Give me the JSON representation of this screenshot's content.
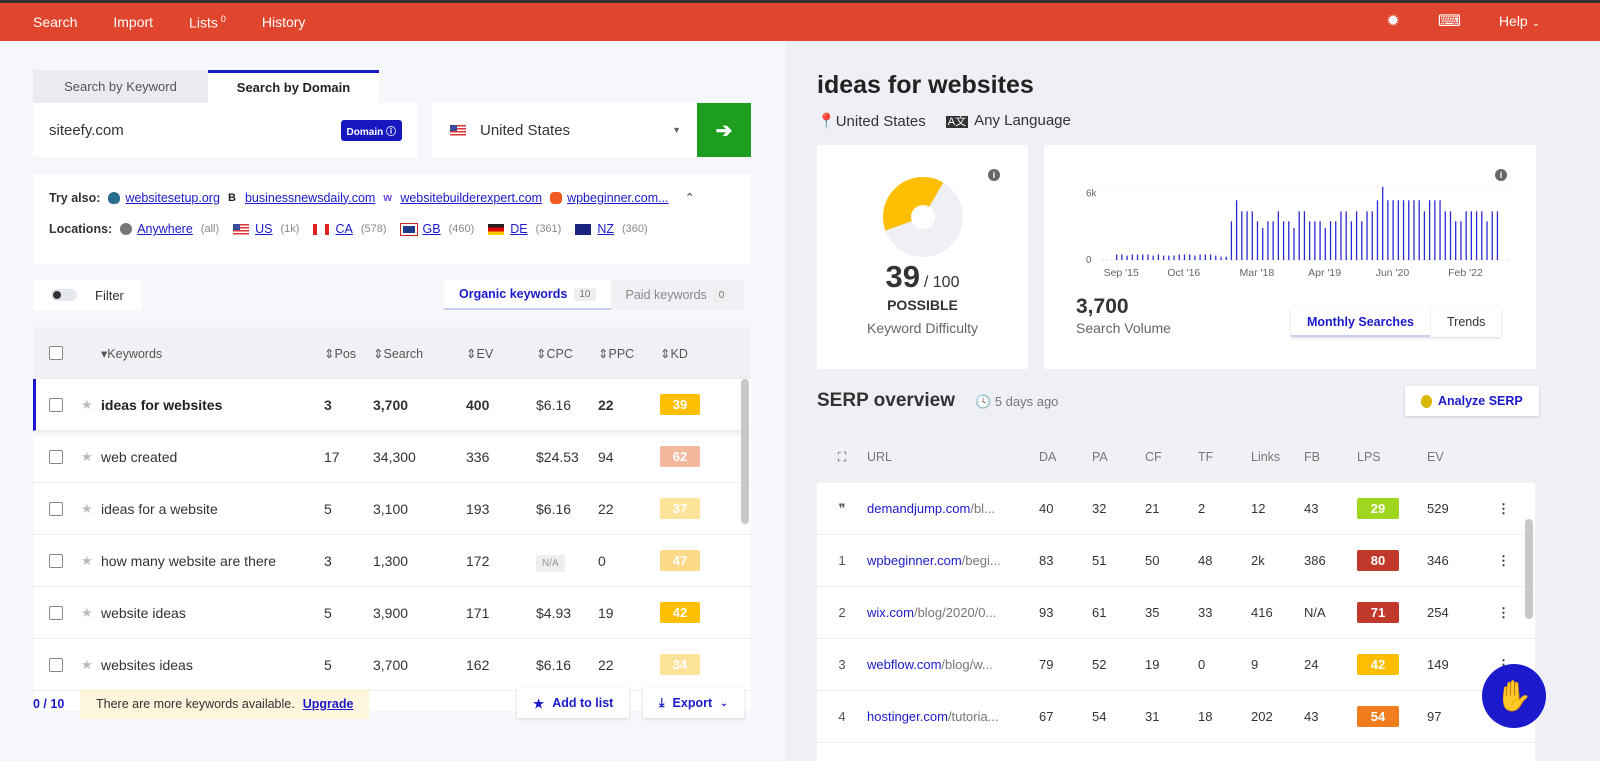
{
  "nav": {
    "items": [
      "Search",
      "Import",
      "Lists",
      "History"
    ],
    "lists_count": "0",
    "help": "Help",
    "icons": [
      "bug-icon",
      "keyboard-icon"
    ]
  },
  "search": {
    "tabs": [
      "Search by Keyword",
      "Search by Domain"
    ],
    "active_tab": "Search by Domain",
    "value": "siteefy.com",
    "badge": "Domain",
    "location": "United States",
    "go_icon": "arrow-right-icon"
  },
  "try_also": {
    "label": "Try also:",
    "sites": [
      "websitesetup.org",
      "businessnewsdaily.com",
      "websitebuilderexpert.com",
      "wpbeginner.com..."
    ],
    "locations_label": "Locations:",
    "locations": [
      {
        "name": "Anywhere",
        "count": "(all)"
      },
      {
        "name": "US",
        "count": "(1k)"
      },
      {
        "name": "CA",
        "count": "(578)"
      },
      {
        "name": "GB",
        "count": "(460)"
      },
      {
        "name": "DE",
        "count": "(361)"
      },
      {
        "name": "NZ",
        "count": "(360)"
      }
    ]
  },
  "filter": {
    "label": "Filter"
  },
  "kw_tabs": [
    {
      "label": "Organic keywords",
      "count": "10"
    },
    {
      "label": "Paid keywords",
      "count": "0"
    }
  ],
  "kw_table": {
    "headers": [
      "Keywords",
      "Pos",
      "Search",
      "EV",
      "CPC",
      "PPC",
      "KD"
    ],
    "rows": [
      {
        "kw": "ideas for websites",
        "pos": "3",
        "search": "3,700",
        "ev": "400",
        "cpc": "$6.16",
        "ppc": "22",
        "kd": "39",
        "color": "#ffbf00"
      },
      {
        "kw": "web created",
        "pos": "17",
        "search": "34,300",
        "ev": "336",
        "cpc": "$24.53",
        "ppc": "94",
        "kd": "62",
        "color": "#f3b79e"
      },
      {
        "kw": "ideas for a website",
        "pos": "5",
        "search": "3,100",
        "ev": "193",
        "cpc": "$6.16",
        "ppc": "22",
        "kd": "37",
        "color": "#fde29a"
      },
      {
        "kw": "how many website are there",
        "pos": "3",
        "search": "1,300",
        "ev": "172",
        "cpc": "N/A",
        "ppc": "0",
        "kd": "47",
        "color": "#fdd98a"
      },
      {
        "kw": "website ideas",
        "pos": "5",
        "search": "3,900",
        "ev": "171",
        "cpc": "$4.93",
        "ppc": "19",
        "kd": "42",
        "color": "#ffbf00"
      },
      {
        "kw": "websites ideas",
        "pos": "5",
        "search": "3,700",
        "ev": "162",
        "cpc": "$6.16",
        "ppc": "22",
        "kd": "34",
        "color": "#fde29a"
      }
    ]
  },
  "footer": {
    "selected": "0 / 10",
    "notice": "There are more keywords available.",
    "upgrade": "Upgrade",
    "add_to_list": "Add to list",
    "export": "Export"
  },
  "keyword": {
    "title": "ideas for websites",
    "location": "United States",
    "language": "Any Language"
  },
  "kd_card": {
    "value": "39",
    "max": "/ 100",
    "level": "POSSIBLE",
    "label": "Keyword Difficulty",
    "fraction": 0.39,
    "color": "#ffbf00"
  },
  "sv_card": {
    "value": "3,700",
    "label": "Search Volume",
    "tabs": [
      "Monthly Searches",
      "Trends"
    ]
  },
  "chart_data": {
    "type": "bar",
    "y_ticks": [
      "0",
      "6k"
    ],
    "ylim": [
      0,
      6600
    ],
    "x_tick_labels": [
      "Sep '15",
      "Oct '16",
      "Mar '18",
      "Apr '19",
      "Jun '20",
      "Feb '22"
    ],
    "color": "#2b2bd6",
    "values": [
      500,
      500,
      400,
      500,
      500,
      500,
      500,
      400,
      500,
      400,
      400,
      400,
      500,
      500,
      500,
      400,
      500,
      500,
      500,
      400,
      300,
      300,
      3500,
      5400,
      4400,
      4400,
      4400,
      3500,
      2900,
      3500,
      3500,
      4400,
      3500,
      3500,
      2900,
      4400,
      4400,
      3500,
      3500,
      3500,
      2900,
      3500,
      3500,
      4400,
      4400,
      3500,
      4400,
      3500,
      4400,
      4400,
      5400,
      6600,
      5400,
      5400,
      5400,
      5400,
      5400,
      5400,
      5400,
      4400,
      5400,
      5400,
      5400,
      4400,
      4400,
      3500,
      3500,
      4400,
      4400,
      4400,
      4400,
      3500,
      4400,
      4400
    ]
  },
  "serp": {
    "title": "SERP overview",
    "ago": "5 days ago",
    "analyze": "Analyze SERP",
    "headers": [
      "URL",
      "DA",
      "PA",
      "CF",
      "TF",
      "Links",
      "FB",
      "LPS",
      "EV"
    ],
    "rows": [
      {
        "i": "",
        "domain": "demandjump.com",
        "path": "/bl...",
        "da": "40",
        "pa": "32",
        "cf": "21",
        "tf": "2",
        "links": "12",
        "fb": "43",
        "lps": "29",
        "ev": "529",
        "color": "#9fd61f"
      },
      {
        "i": "1",
        "domain": "wpbeginner.com",
        "path": "/begi...",
        "da": "83",
        "pa": "51",
        "cf": "50",
        "tf": "48",
        "links": "2k",
        "fb": "386",
        "lps": "80",
        "ev": "346",
        "color": "#c0392b"
      },
      {
        "i": "2",
        "domain": "wix.com",
        "path": "/blog/2020/0...",
        "da": "93",
        "pa": "61",
        "cf": "35",
        "tf": "33",
        "links": "416",
        "fb": "N/A",
        "lps": "71",
        "ev": "254",
        "color": "#c0392b"
      },
      {
        "i": "3",
        "domain": "webflow.com",
        "path": "/blog/w...",
        "da": "79",
        "pa": "52",
        "cf": "19",
        "tf": "0",
        "links": "9",
        "fb": "24",
        "lps": "42",
        "ev": "149",
        "color": "#ffbf00"
      },
      {
        "i": "4",
        "domain": "hostinger.com",
        "path": "/tutoria...",
        "da": "67",
        "pa": "54",
        "cf": "31",
        "tf": "18",
        "links": "202",
        "fb": "43",
        "lps": "54",
        "ev": "97",
        "color": "#f07e1e"
      }
    ]
  }
}
